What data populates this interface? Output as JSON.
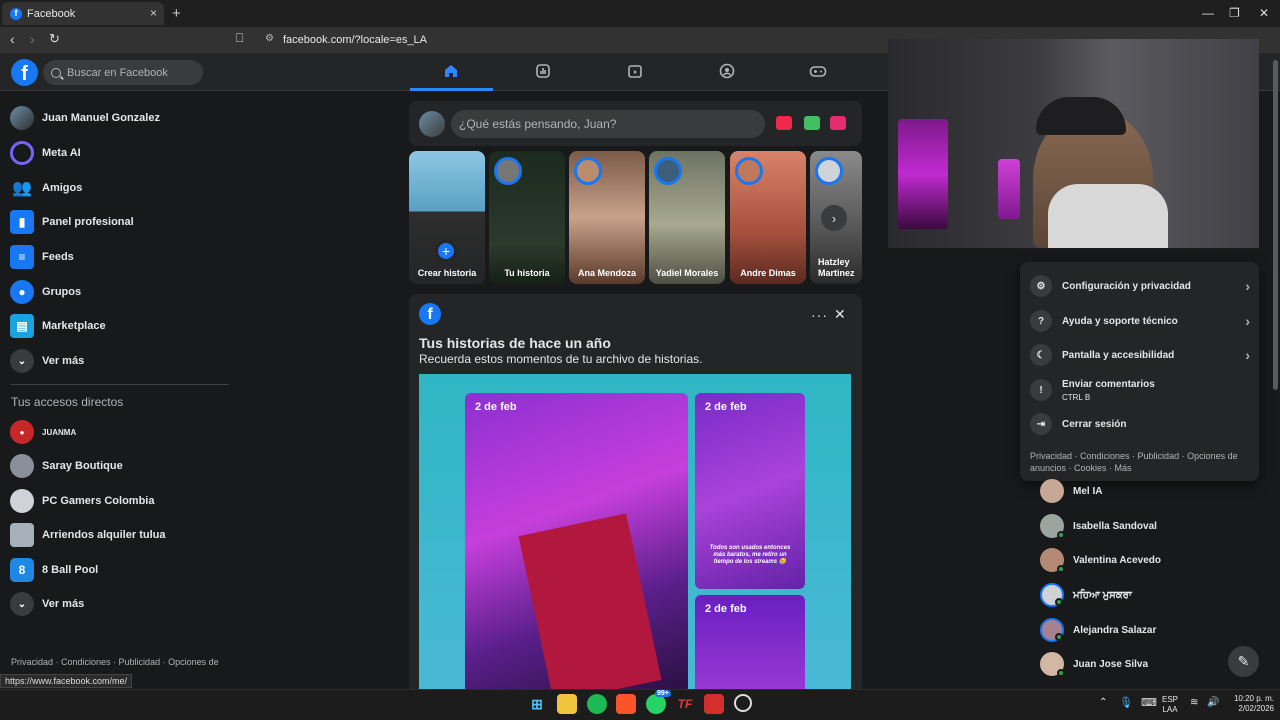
{
  "browser": {
    "tab_title": "Facebook",
    "tab_close": "×",
    "new_tab": "+",
    "url": "facebook.com/?locale=es_LA",
    "status_url": "https://www.facebook.com/me/"
  },
  "header": {
    "logo": "f",
    "search_placeholder": "Buscar en Facebook",
    "nav_icons": [
      "home-icon",
      "dashboard-icon",
      "video-icon",
      "groups-icon",
      "gaming-icon"
    ]
  },
  "sidebar": {
    "items": [
      {
        "label": "Juan Manuel Gonzalez",
        "icon": "profile-avatar"
      },
      {
        "label": "Meta AI",
        "icon": "meta-ai-icon"
      },
      {
        "label": "Amigos",
        "icon": "friends-icon"
      },
      {
        "label": "Panel profesional",
        "icon": "dashboard-icon"
      },
      {
        "label": "Feeds",
        "icon": "feeds-icon"
      },
      {
        "label": "Grupos",
        "icon": "groups-icon"
      },
      {
        "label": "Marketplace",
        "icon": "marketplace-icon"
      },
      {
        "label": "Ver más",
        "icon": "chevron-down-icon"
      }
    ],
    "shortcuts_header": "Tus accesos directos",
    "shortcuts": [
      {
        "label": "JUANMA"
      },
      {
        "label": "Saray Boutique"
      },
      {
        "label": "PC Gamers Colombia"
      },
      {
        "label": "Arriendos alquiler tulua"
      },
      {
        "label": "8 Ball Pool"
      },
      {
        "label": "Ver más"
      }
    ],
    "footer": "Privacidad · Condiciones · Publicidad · Opciones de anuncios · Cookies · Más"
  },
  "composer": {
    "placeholder": "¿Qué estás pensando, Juan?"
  },
  "stories": [
    {
      "label": "Crear historia"
    },
    {
      "label": "Tu historia"
    },
    {
      "label": "Ana Mendoza"
    },
    {
      "label": "Yadiel Morales"
    },
    {
      "label": "Andre Dimas"
    },
    {
      "label": "Hatzley Martinez"
    }
  ],
  "memories": {
    "title": "Tus historias de hace un año",
    "subtitle": "Recuerda estos momentos de tu archivo de historias.",
    "dates": [
      "2 de feb",
      "2 de feb",
      "2 de feb"
    ],
    "caption": "Todos son usados entonces más baratos, me retiro un tiempo de los streams 😢"
  },
  "menu": {
    "items": [
      {
        "label": "Configuración y privacidad",
        "icon": "gear-icon"
      },
      {
        "label": "Ayuda y soporte técnico",
        "icon": "help-icon"
      },
      {
        "label": "Pantalla y accesibilidad",
        "icon": "moon-icon"
      },
      {
        "label": "Enviar comentarios",
        "sub": "CTRL B",
        "icon": "feedback-icon"
      },
      {
        "label": "Cerrar sesión",
        "icon": "logout-icon"
      }
    ],
    "footer": "Privacidad · Condiciones · Publicidad · Opciones de anuncios · Cookies · Más"
  },
  "contacts": [
    {
      "name": "Mel IA"
    },
    {
      "name": "Isabella Sandoval"
    },
    {
      "name": "Valentina Acevedo"
    },
    {
      "name": "ਮਹਿਆ ਮੁਸਕਰਾ"
    },
    {
      "name": "Alejandra Salazar"
    },
    {
      "name": "Juan Jose Silva"
    }
  ],
  "taskbar": {
    "badge": "99+",
    "lang": "ESP",
    "lang2": "LAA",
    "time": "10:20 p. m.",
    "date": "2/02/2026"
  },
  "colors": {
    "accent": "#1877f2",
    "background": "#18191a",
    "surface": "#242526"
  }
}
